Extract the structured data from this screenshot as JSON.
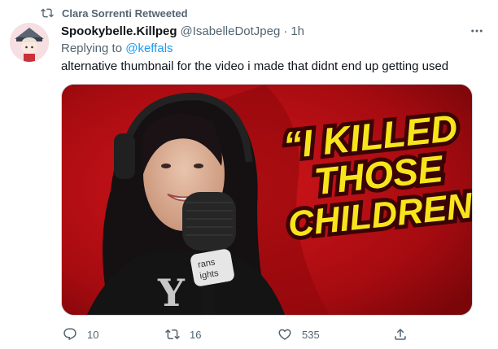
{
  "retweet_banner": {
    "text": "Clara Sorrenti Retweeted",
    "icon": "retweet-icon"
  },
  "author": {
    "display_name": "Spookybelle.Killpeg",
    "handle": "@IsabelleDotJpeg",
    "separator": "·",
    "time": "1h"
  },
  "reply": {
    "prefix": "Replying to",
    "mention": "@keffals"
  },
  "tweet": {
    "text": "alternative thumbnail for the video i made that didnt end up getting used"
  },
  "media": {
    "headline_lines": [
      "“I KILLED",
      "THOSE",
      "CHILDREN”"
    ],
    "mic_sticker_lines": [
      "rans",
      "ights"
    ],
    "shirt_text": "Y",
    "background_color": "#b80d12",
    "headline_color": "#f7e51b"
  },
  "actions": {
    "reply_count": "10",
    "retweet_count": "16",
    "like_count": "535"
  },
  "icons": [
    "retweet-icon",
    "more-icon",
    "reply-icon",
    "retweet-icon",
    "heart-icon",
    "share-icon"
  ],
  "colors": {
    "link": "#1d9bf0",
    "muted": "#536471",
    "text": "#0f1419"
  }
}
